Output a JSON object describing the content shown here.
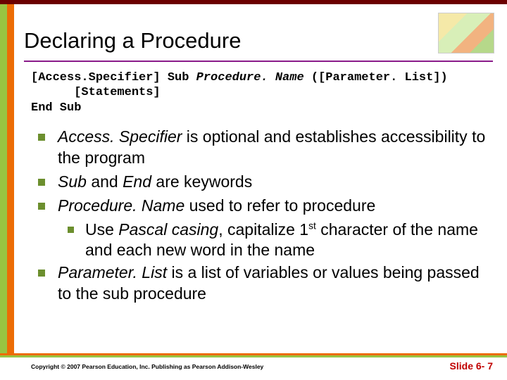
{
  "title": "Declaring a Procedure",
  "code": {
    "line1a": "[Access.Specifier] Sub ",
    "line1b": "Procedure. Name",
    "line1c": " ([Parameter. List])",
    "line2": "      [Statements]",
    "line3": "End Sub"
  },
  "bullets": [
    {
      "html": "<span class='ital'>Access. Specifier</span> is optional and establishes accessibility to the program"
    },
    {
      "html": "<span class='ital'>Sub</span> and <span class='ital'>End</span> are keywords"
    },
    {
      "html": "<span class='ital'>Procedure. Name</span> used to refer to procedure",
      "sub": [
        {
          "html": "Use <span class='ital'>Pascal casing</span>, capitalize 1<sup>st</sup> character of the name and each new word in the name"
        }
      ]
    },
    {
      "html": "<span class='ital'>Parameter. List</span> is a list of variables or values being passed to the sub procedure"
    }
  ],
  "footer": {
    "copyright": "Copyright © 2007 Pearson Education, Inc. Publishing as Pearson Addison-Wesley",
    "slide": "Slide 6- 7"
  }
}
